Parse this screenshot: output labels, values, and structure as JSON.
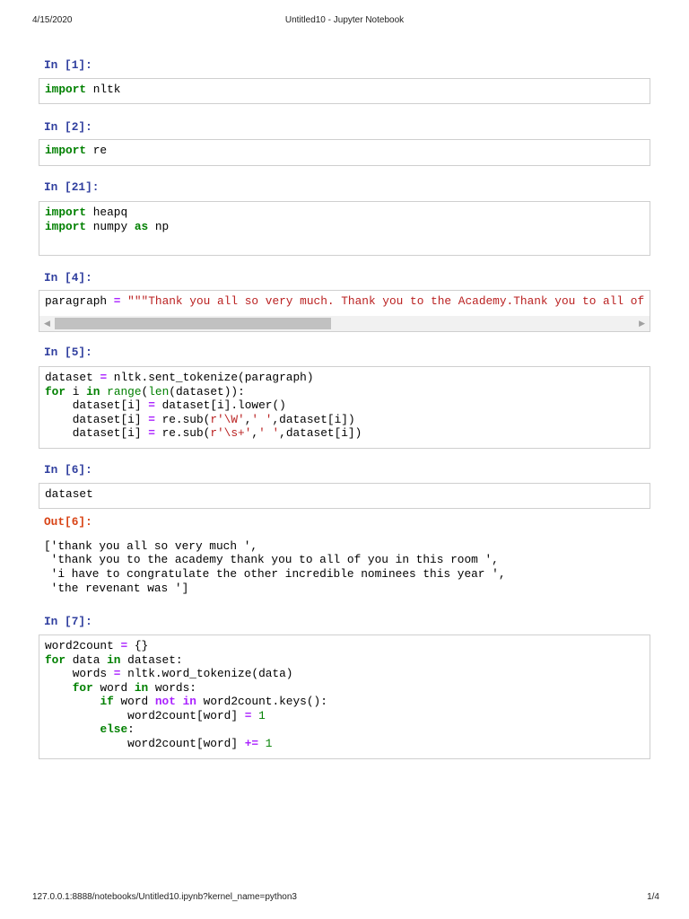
{
  "header": {
    "date": "4/15/2020",
    "title": "Untitled10 - Jupyter Notebook"
  },
  "footer": {
    "url": "127.0.0.1:8888/notebooks/Untitled10.ipynb?kernel_name=python3",
    "page": "1/4"
  },
  "cells": [
    {
      "prompt": "In [1]:",
      "lines": [
        [
          [
            "import",
            "kw"
          ],
          [
            " nltk",
            ""
          ]
        ]
      ]
    },
    {
      "prompt": "In [2]:",
      "lines": [
        [
          [
            "import",
            "kw"
          ],
          [
            " re",
            ""
          ]
        ]
      ]
    },
    {
      "prompt": "In [21]:",
      "lines": [
        [
          [
            "import",
            "kw"
          ],
          [
            " heapq",
            ""
          ]
        ],
        [
          [
            "import",
            "kw"
          ],
          [
            " numpy ",
            ""
          ],
          [
            "as",
            "kw"
          ],
          [
            " np",
            ""
          ]
        ]
      ]
    },
    {
      "prompt": "In [4]:",
      "lines": [
        [
          [
            "paragraph ",
            ""
          ],
          [
            "=",
            "op"
          ],
          [
            " ",
            ""
          ],
          [
            "\"\"\"Thank you all so very much. Thank you to the Academy.Thank you to all of you in this room",
            "str"
          ]
        ]
      ],
      "scroll_position": 0.45
    },
    {
      "prompt": "In [5]:",
      "lines": [
        [
          [
            "dataset ",
            ""
          ],
          [
            "=",
            "op"
          ],
          [
            " nltk.sent_tokenize(paragraph)",
            ""
          ]
        ],
        [
          [
            "for",
            "kw"
          ],
          [
            " i ",
            ""
          ],
          [
            "in",
            "kw"
          ],
          [
            " ",
            ""
          ],
          [
            "range",
            "bi"
          ],
          [
            "(",
            ""
          ],
          [
            "len",
            "bi"
          ],
          [
            "(dataset)):",
            ""
          ]
        ],
        [
          [
            "    dataset[i] ",
            ""
          ],
          [
            "=",
            "op"
          ],
          [
            " dataset[i].lower()",
            ""
          ]
        ],
        [
          [
            "    dataset[i] ",
            ""
          ],
          [
            "=",
            "op"
          ],
          [
            " re.sub(",
            ""
          ],
          [
            "r'\\W'",
            "str"
          ],
          [
            ",",
            ""
          ],
          [
            "' '",
            "str"
          ],
          [
            ",dataset[i])",
            ""
          ]
        ],
        [
          [
            "    dataset[i] ",
            ""
          ],
          [
            "=",
            "op"
          ],
          [
            " re.sub(",
            ""
          ],
          [
            "r'\\s+'",
            "str"
          ],
          [
            ",",
            ""
          ],
          [
            "' '",
            "str"
          ],
          [
            ",dataset[i])",
            ""
          ]
        ]
      ]
    },
    {
      "prompt": "In [6]:",
      "lines": [
        [
          [
            "dataset",
            ""
          ]
        ]
      ],
      "out_prompt": "Out[6]:",
      "output": [
        "['thank you all so very much ',",
        " 'thank you to the academy thank you to all of you in this room ',",
        " 'i have to congratulate the other incredible nominees this year ',",
        " 'the revenant was ']"
      ]
    },
    {
      "prompt": "In [7]:",
      "lines": [
        [
          [
            "word2count ",
            ""
          ],
          [
            "=",
            "op"
          ],
          [
            " {}",
            ""
          ]
        ],
        [
          [
            "for",
            "kw"
          ],
          [
            " data ",
            ""
          ],
          [
            "in",
            "kw"
          ],
          [
            " dataset:",
            ""
          ]
        ],
        [
          [
            "    words ",
            ""
          ],
          [
            "=",
            "op"
          ],
          [
            " nltk.word_tokenize(data)",
            ""
          ]
        ],
        [
          [
            "    ",
            ""
          ],
          [
            "for",
            "kw"
          ],
          [
            " word ",
            ""
          ],
          [
            "in",
            "kw"
          ],
          [
            " words:",
            ""
          ]
        ],
        [
          [
            "        ",
            ""
          ],
          [
            "if",
            "kw"
          ],
          [
            " word ",
            ""
          ],
          [
            "not",
            "op"
          ],
          [
            " ",
            ""
          ],
          [
            "in",
            "op"
          ],
          [
            " word2count.keys():",
            ""
          ]
        ],
        [
          [
            "            word2count[word] ",
            ""
          ],
          [
            "=",
            "op"
          ],
          [
            " ",
            ""
          ],
          [
            "1",
            "num"
          ]
        ],
        [
          [
            "        ",
            ""
          ],
          [
            "else",
            "kw"
          ],
          [
            ":",
            ""
          ]
        ],
        [
          [
            "            word2count[word] ",
            ""
          ],
          [
            "+=",
            "op"
          ],
          [
            " ",
            ""
          ],
          [
            "1",
            "num"
          ]
        ]
      ]
    }
  ]
}
